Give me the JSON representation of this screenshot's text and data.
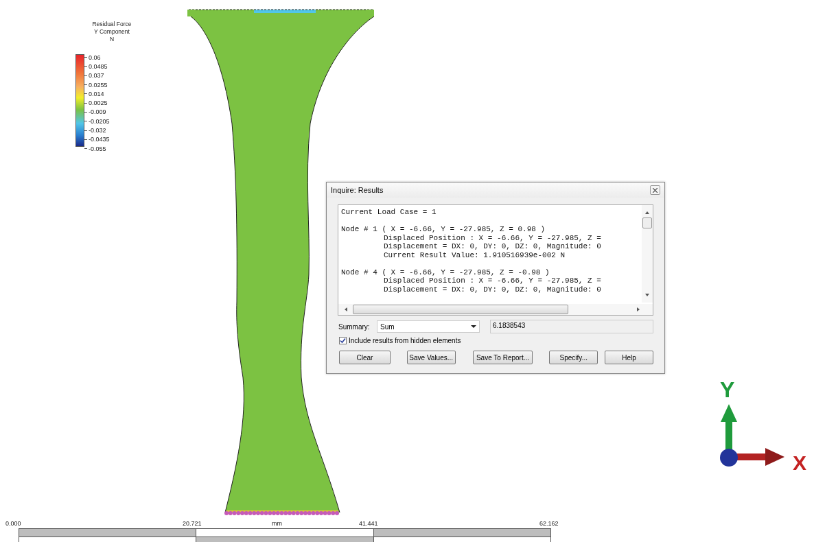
{
  "legend": {
    "title": [
      "Residual Force",
      "Y Component",
      "N"
    ],
    "ticks": [
      "0.06",
      "0.0485",
      "0.037",
      "0.0255",
      "0.014",
      "0.0025",
      "-0.009",
      "-0.0205",
      "-0.032",
      "-0.0435",
      "-0.055"
    ]
  },
  "dialog": {
    "title": "Inquire: Results",
    "blocks": [
      {
        "heading": "Current Load Case = 1"
      },
      {
        "heading": "Node # 1 ( X = -6.66, Y = -27.985, Z = 0.98 )",
        "details": [
          "Displaced Position : X = -6.66, Y = -27.985, Z =",
          "Displacement = DX: 0, DY: 0, DZ: 0, Magnitude: 0",
          "Current Result Value: 1.910516939e-002 N"
        ]
      },
      {
        "heading": "Node # 4 ( X = -6.66, Y = -27.985, Z = -0.98 )",
        "details": [
          "Displaced Position : X = -6.66, Y = -27.985, Z =",
          "Displacement = DX: 0, DY: 0, DZ: 0, Magnitude: 0"
        ]
      }
    ],
    "summary_label": "Summary:",
    "summary_value": "Sum",
    "result": "6.1838543",
    "include_hidden": {
      "label": "Include results from hidden elements",
      "checked": true
    },
    "buttons": [
      "Clear",
      "Save Values...",
      "Save To Report...",
      "Specify...",
      "Help"
    ]
  },
  "triad": {
    "y_label": "Y",
    "x_label": "X"
  },
  "scale_bar": {
    "ticks": [
      "0.000",
      "20.721",
      "41.441",
      "62.162"
    ],
    "unit": "mm"
  }
}
